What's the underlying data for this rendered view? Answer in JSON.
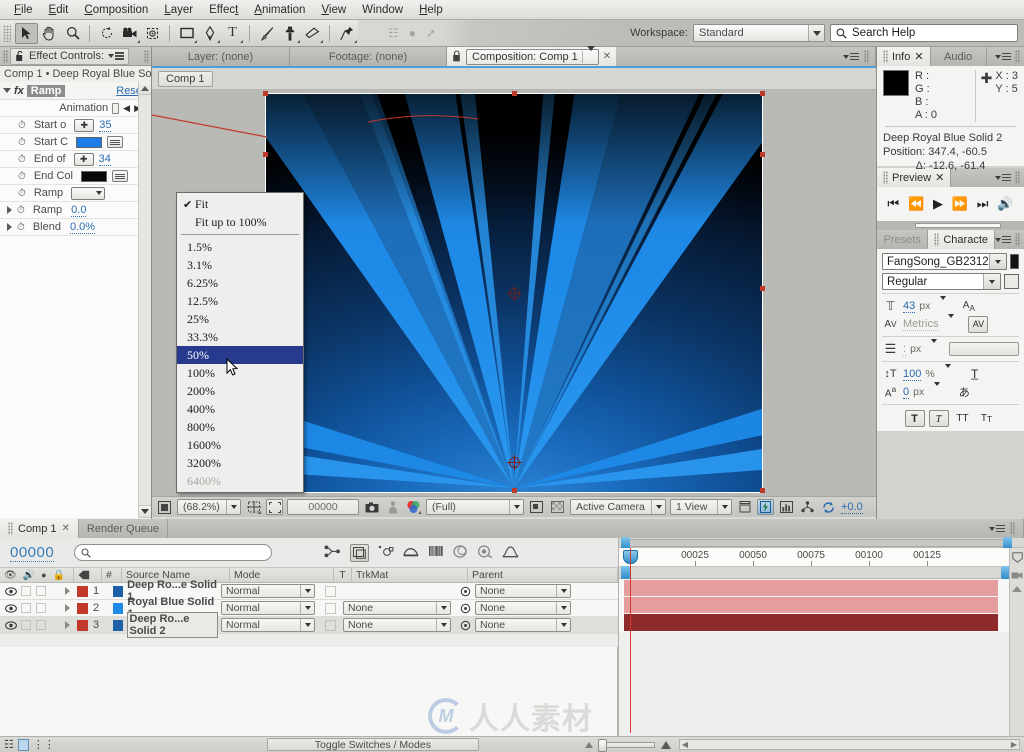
{
  "menubar": [
    "File",
    "Edit",
    "Composition",
    "Layer",
    "Effect",
    "Animation",
    "View",
    "Window",
    "Help"
  ],
  "toolbar": {
    "workspace_label": "Workspace:",
    "workspace_value": "Standard",
    "search_placeholder": "Search Help",
    "tools": [
      "selection-tool",
      "hand-tool",
      "zoom-tool",
      "rotation-tool",
      "camera-tool",
      "pan-behind-tool",
      "shape-tool",
      "pen-tool",
      "text-tool",
      "brush-tool",
      "clone-stamp-tool",
      "eraser-tool",
      "puppet-pin-tool"
    ]
  },
  "effect_controls": {
    "tab_label": "Effect Controls:",
    "breadcrumb": "Comp 1 • Deep Royal Blue Sol",
    "effect_name": "Ramp",
    "reset_label": "Reset",
    "animation_label": "Animation",
    "rows": [
      {
        "label": "Start o",
        "value": "35",
        "kind": "point"
      },
      {
        "label": "Start C",
        "value": "",
        "kind": "color",
        "color": "#1e7ce8"
      },
      {
        "label": "End of",
        "value": "34",
        "kind": "point"
      },
      {
        "label": "End Col",
        "value": "",
        "kind": "color",
        "color": "#080808"
      },
      {
        "label": "Ramp",
        "value": "",
        "kind": "combo"
      },
      {
        "label": "Ramp",
        "value": "0.0",
        "kind": "expand"
      },
      {
        "label": "Blend",
        "value": "0.0%",
        "kind": "expand"
      }
    ]
  },
  "comp_panel": {
    "tabs": [
      {
        "label": "Layer: (none)",
        "selected": false
      },
      {
        "label": "Footage: (none)",
        "selected": false
      },
      {
        "label": "Composition: Comp 1",
        "selected": true
      }
    ],
    "chip": "Comp 1",
    "bottom": {
      "magnification": "(68.2%)",
      "timecode": "00000",
      "resolution": "(Full)",
      "camera": "Active Camera",
      "views": "1 View",
      "exposure": "+0.0"
    }
  },
  "zoom_menu": {
    "top": [
      {
        "label": "Fit",
        "checked": true
      },
      {
        "label": "Fit up to 100%",
        "checked": false
      }
    ],
    "levels": [
      {
        "label": "1.5%",
        "state": "normal"
      },
      {
        "label": "3.1%",
        "state": "normal"
      },
      {
        "label": "6.25%",
        "state": "normal"
      },
      {
        "label": "12.5%",
        "state": "normal"
      },
      {
        "label": "25%",
        "state": "normal"
      },
      {
        "label": "33.3%",
        "state": "normal"
      },
      {
        "label": "50%",
        "state": "selected"
      },
      {
        "label": "100%",
        "state": "normal"
      },
      {
        "label": "200%",
        "state": "normal"
      },
      {
        "label": "400%",
        "state": "normal"
      },
      {
        "label": "800%",
        "state": "normal"
      },
      {
        "label": "1600%",
        "state": "normal"
      },
      {
        "label": "3200%",
        "state": "normal"
      },
      {
        "label": "6400%",
        "state": "disabled"
      }
    ]
  },
  "info_panel": {
    "tabs": [
      {
        "label": "Info",
        "selected": true
      },
      {
        "label": "Audio",
        "selected": false
      }
    ],
    "channels": [
      "R :",
      "G :",
      "B :",
      "A : 0"
    ],
    "coord_x": "X : 3",
    "coord_y": "Y : 5",
    "layer_name": "Deep Royal Blue Solid 2",
    "position": "Position: 347.4, -60.5",
    "delta": "Δ: -12.6, -61.4"
  },
  "preview_panel": {
    "tab": "Preview",
    "buttons": [
      "first-frame",
      "prev-frame",
      "play",
      "next-frame",
      "last-frame",
      "audio-toggle"
    ]
  },
  "character_panel": {
    "tabs": [
      {
        "label": "Presets",
        "selected": false
      },
      {
        "label": "Characte",
        "selected": true
      }
    ],
    "font_family": "FangSong_GB2312",
    "font_style": "Regular",
    "font_size": "43",
    "font_size_unit": "px",
    "kerning": "Metrics",
    "leading_value": ":",
    "leading_unit": "px",
    "vertical_scale": "100",
    "vertical_scale_unit": "%",
    "baseline_shift": "0",
    "baseline_unit": "px",
    "style_buttons": [
      "T",
      "T-italic",
      "TT",
      "Tr"
    ]
  },
  "timeline": {
    "tabs": [
      {
        "label": "Comp 1",
        "selected": true
      },
      {
        "label": "Render Queue",
        "selected": false
      }
    ],
    "current_time": "00000",
    "search_placeholder": "",
    "columns": [
      "#",
      "Source Name",
      "Mode",
      "T",
      "TrkMat",
      "Parent"
    ],
    "layers": [
      {
        "index": "1",
        "name": "Deep Ro...e Solid 1",
        "swatch": "#1d5fa8",
        "label_color": "#c0392b",
        "mode": "Normal",
        "trkmat": "",
        "parent": "None",
        "selected": false,
        "bar_color": "#e59d9d"
      },
      {
        "index": "2",
        "name": "Royal Blue Solid 1",
        "swatch": "#1e8ae8",
        "label_color": "#c0392b",
        "mode": "Normal",
        "trkmat": "None",
        "parent": "None",
        "selected": false,
        "bar_color": "#e59d9d"
      },
      {
        "index": "3",
        "name": "Deep Ro...e Solid 2",
        "swatch": "#1d5fa8",
        "label_color": "#c0392b",
        "mode": "Normal",
        "trkmat": "None",
        "parent": "None",
        "selected": true,
        "bar_color": "#8e2a2a"
      }
    ],
    "ruler_labels": [
      "00025",
      "00050",
      "00075",
      "00100",
      "00125"
    ],
    "toggle_label": "Toggle Switches / Modes"
  },
  "watermark": {
    "text": "人人素材",
    "mark": "M"
  },
  "colors": {
    "accent_blue": "#2b6cb0",
    "selection_navy": "#283a8e",
    "ray_bright": "#1e8ae8",
    "ray_mid": "#1f72c4",
    "bg_dark": "#0a1526",
    "label_red": "#c0392b"
  }
}
